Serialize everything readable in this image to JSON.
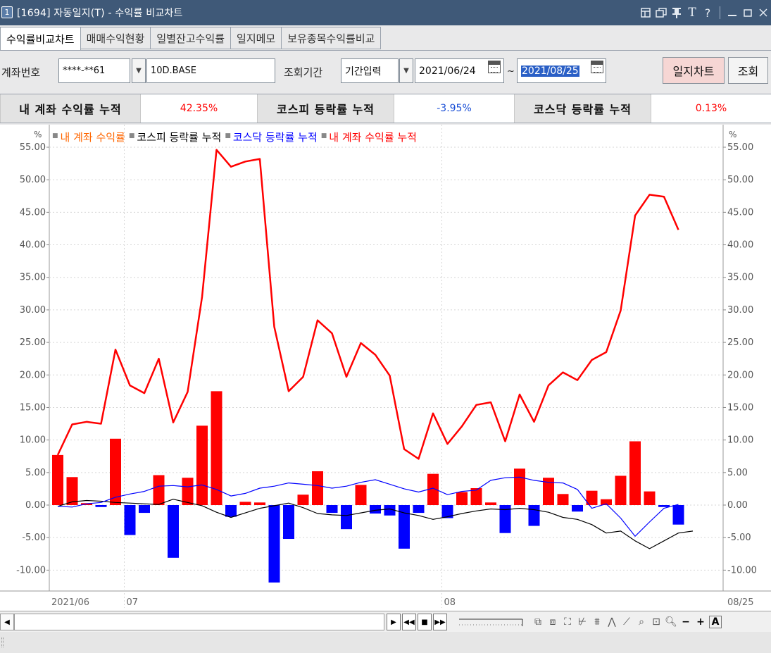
{
  "window": {
    "icon_label": "1",
    "title": "[1694] 자동일지(T) - 수익률 비교차트",
    "buttons": [
      "⧉",
      "⧉",
      "⊤",
      "T",
      "?",
      "—",
      "□",
      "✕"
    ]
  },
  "tabs": [
    {
      "label": "수익률비교차트",
      "active": true
    },
    {
      "label": "매매수익현황",
      "active": false
    },
    {
      "label": "일별잔고수익률",
      "active": false
    },
    {
      "label": "일지메모",
      "active": false
    },
    {
      "label": "보유종목수익률비교",
      "active": false
    }
  ],
  "toolbar": {
    "account_label": "계좌번호",
    "account_value": "****-**61",
    "account_type": "10D.BASE",
    "period_label": "조회기간",
    "period_mode": "기간입력",
    "start_date": "2021/06/24",
    "tilde": "~",
    "end_date": "2021/08/25",
    "journal_chart_btn": "일지차트",
    "search_btn": "조회"
  },
  "summary": {
    "my_label": "내 계좌 수익률 누적",
    "my_value": "42.35%",
    "kospi_label": "코스피 등락률 누적",
    "kospi_value": "-3.95%",
    "kosdaq_label": "코스닥 등락률 누적",
    "kosdaq_value": "0.13%"
  },
  "colors": {
    "red": "#ff0000",
    "blue": "#0000ff",
    "black": "#000000",
    "legend_orange": "#ff6600"
  },
  "legend": [
    {
      "label": "내 계좌 수익률",
      "color": "#ff6600"
    },
    {
      "label": "코스피 등락률 누적",
      "color": "#000000"
    },
    {
      "label": "코스닥 등락률 누적",
      "color": "#0000ff"
    },
    {
      "label": "내 계좌 수익률 누적",
      "color": "#ff0000"
    }
  ],
  "chart_data": {
    "type": "bar",
    "y_unit": "%",
    "ylim": [
      -12,
      55
    ],
    "yticks": [
      "55.00",
      "50.00",
      "45.00",
      "40.00",
      "35.00",
      "30.00",
      "25.00",
      "20.00",
      "15.00",
      "10.00",
      "5.00",
      "0.00",
      "-5.00",
      "-10.00"
    ],
    "ytick_values": [
      55,
      50,
      45,
      40,
      35,
      30,
      25,
      20,
      15,
      10,
      5,
      0,
      -5,
      -10
    ],
    "x_tick_labels": [
      {
        "label": "2021/06",
        "index": 0
      },
      {
        "label": "07",
        "index": 5
      },
      {
        "label": "08",
        "index": 27
      },
      {
        "label": "08/25",
        "index": 43
      }
    ],
    "series": [
      {
        "name": "내 계좌 수익률",
        "type": "bar",
        "values": [
          7.7,
          4.3,
          0.3,
          -0.3,
          10.2,
          -4.6,
          -1.2,
          4.6,
          -8.1,
          4.2,
          12.2,
          17.5,
          -1.8,
          0.5,
          0.4,
          -11.9,
          -5.2,
          1.6,
          5.2,
          -1.2,
          -3.7,
          3.1,
          -1.3,
          -1.6,
          -6.7,
          -1.2,
          4.8,
          -2.0,
          2.0,
          2.6,
          0.4,
          -4.3,
          5.6,
          -3.2,
          4.2,
          1.7,
          -1.0,
          2.2,
          0.9,
          4.5,
          9.8,
          2.1,
          -0.3,
          -3.0
        ]
      },
      {
        "name": "코스피 등락률 누적",
        "type": "line",
        "values": [
          -0.2,
          0.5,
          0.7,
          0.6,
          0.4,
          0.3,
          0.2,
          0.1,
          0.9,
          0.4,
          -0.1,
          -1.1,
          -1.9,
          -1.2,
          -0.5,
          -0.1,
          0.3,
          -0.4,
          -1.3,
          -1.5,
          -1.6,
          -1.2,
          -0.8,
          -0.6,
          -1.2,
          -1.6,
          -2.2,
          -1.8,
          -1.3,
          -0.9,
          -0.6,
          -0.7,
          -0.5,
          -0.7,
          -1.1,
          -1.9,
          -2.2,
          -3.0,
          -4.3,
          -4.0,
          -5.5,
          -6.7,
          -5.5,
          -4.3,
          -4.0
        ]
      },
      {
        "name": "코스닥 등락률 누적",
        "type": "line",
        "values": [
          -0.2,
          -0.3,
          0.2,
          0.4,
          1.2,
          1.7,
          2.1,
          2.9,
          3.0,
          2.8,
          3.1,
          2.4,
          1.4,
          1.8,
          2.6,
          2.9,
          3.4,
          3.2,
          3.0,
          2.6,
          2.9,
          3.5,
          3.9,
          3.2,
          2.5,
          2.0,
          2.6,
          1.6,
          2.1,
          2.3,
          3.8,
          4.2,
          4.3,
          3.8,
          3.5,
          3.4,
          2.4,
          -0.5,
          0.2,
          -2.0,
          -4.8,
          -2.6,
          -0.5,
          0.1
        ]
      },
      {
        "name": "내 계좌 수익률 누적",
        "type": "line",
        "values": [
          7.7,
          12.4,
          12.8,
          12.5,
          23.9,
          18.4,
          17.2,
          22.5,
          12.7,
          17.4,
          32.0,
          54.6,
          52.0,
          52.8,
          53.2,
          27.4,
          17.5,
          19.7,
          28.4,
          26.4,
          19.7,
          24.9,
          23.1,
          19.9,
          8.6,
          7.1,
          14.1,
          9.4,
          12.1,
          15.4,
          15.8,
          9.8,
          17.0,
          12.8,
          18.4,
          20.4,
          19.2,
          22.3,
          23.5,
          29.9,
          44.5,
          47.7,
          47.4,
          42.3
        ]
      }
    ]
  }
}
